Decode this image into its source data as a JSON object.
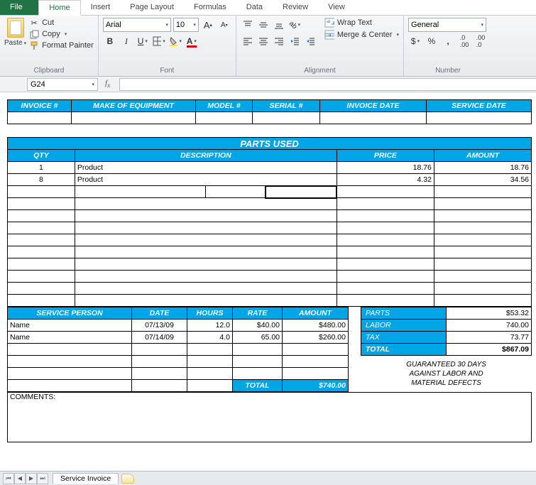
{
  "tabs": {
    "file": "File",
    "home": "Home",
    "insert": "Insert",
    "page_layout": "Page Layout",
    "formulas": "Formulas",
    "data": "Data",
    "review": "Review",
    "view": "View"
  },
  "ribbon": {
    "clipboard": {
      "paste": "Paste",
      "cut": "Cut",
      "copy": "Copy",
      "format_painter": "Format Painter",
      "label": "Clipboard"
    },
    "font": {
      "name": "Arial",
      "size": "10",
      "label": "Font"
    },
    "alignment": {
      "wrap": "Wrap Text",
      "merge": "Merge & Center",
      "label": "Alignment"
    },
    "number": {
      "format": "General",
      "label": "Number"
    }
  },
  "name_box": "G24",
  "invoice_headers": {
    "invoice_no": "INVOICE #",
    "make": "MAKE OF EQUIPMENT",
    "model": "MODEL #",
    "serial": "SERIAL #",
    "invoice_date": "INVOICE DATE",
    "service_date": "SERVICE DATE"
  },
  "parts": {
    "title": "PARTS USED",
    "cols": {
      "qty": "QTY",
      "desc": "DESCRIPTION",
      "price": "PRICE",
      "amount": "AMOUNT"
    },
    "rows": [
      {
        "qty": "1",
        "desc": "Product",
        "price": "18.76",
        "amount": "18.76"
      },
      {
        "qty": "8",
        "desc": "Product",
        "price": "4.32",
        "amount": "34.56"
      }
    ]
  },
  "service": {
    "cols": {
      "person": "SERVICE PERSON",
      "date": "DATE",
      "hours": "HOURS",
      "rate": "RATE",
      "amount": "AMOUNT"
    },
    "rows": [
      {
        "person": "Name",
        "date": "07/13/09",
        "hours": "12.0",
        "rate": "$40.00",
        "amount": "$480.00"
      },
      {
        "person": "Name",
        "date": "07/14/09",
        "hours": "4.0",
        "rate": "65.00",
        "amount": "$260.00"
      }
    ],
    "total_label": "TOTAL",
    "total_value": "$740.00"
  },
  "summary": {
    "parts": {
      "label": "PARTS",
      "value": "$53.32"
    },
    "labor": {
      "label": "LABOR",
      "value": "740.00"
    },
    "tax": {
      "label": "TAX",
      "value": "73.77"
    },
    "total": {
      "label": "TOTAL",
      "value": "$867.09"
    }
  },
  "guarantee": {
    "l1": "GUARANTEED 30 DAYS",
    "l2": "AGAINST LABOR AND",
    "l3": "MATERIAL DEFECTS"
  },
  "comments_label": "COMMENTS:",
  "sheet_tab": "Service Invoice"
}
